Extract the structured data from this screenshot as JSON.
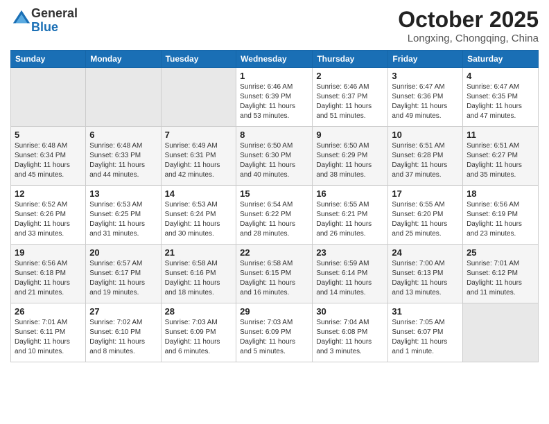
{
  "logo": {
    "general": "General",
    "blue": "Blue"
  },
  "header": {
    "month": "October 2025",
    "location": "Longxing, Chongqing, China"
  },
  "days_of_week": [
    "Sunday",
    "Monday",
    "Tuesday",
    "Wednesday",
    "Thursday",
    "Friday",
    "Saturday"
  ],
  "weeks": [
    [
      {
        "day": "",
        "info": ""
      },
      {
        "day": "",
        "info": ""
      },
      {
        "day": "",
        "info": ""
      },
      {
        "day": "1",
        "info": "Sunrise: 6:46 AM\nSunset: 6:39 PM\nDaylight: 11 hours\nand 53 minutes."
      },
      {
        "day": "2",
        "info": "Sunrise: 6:46 AM\nSunset: 6:37 PM\nDaylight: 11 hours\nand 51 minutes."
      },
      {
        "day": "3",
        "info": "Sunrise: 6:47 AM\nSunset: 6:36 PM\nDaylight: 11 hours\nand 49 minutes."
      },
      {
        "day": "4",
        "info": "Sunrise: 6:47 AM\nSunset: 6:35 PM\nDaylight: 11 hours\nand 47 minutes."
      }
    ],
    [
      {
        "day": "5",
        "info": "Sunrise: 6:48 AM\nSunset: 6:34 PM\nDaylight: 11 hours\nand 45 minutes."
      },
      {
        "day": "6",
        "info": "Sunrise: 6:48 AM\nSunset: 6:33 PM\nDaylight: 11 hours\nand 44 minutes."
      },
      {
        "day": "7",
        "info": "Sunrise: 6:49 AM\nSunset: 6:31 PM\nDaylight: 11 hours\nand 42 minutes."
      },
      {
        "day": "8",
        "info": "Sunrise: 6:50 AM\nSunset: 6:30 PM\nDaylight: 11 hours\nand 40 minutes."
      },
      {
        "day": "9",
        "info": "Sunrise: 6:50 AM\nSunset: 6:29 PM\nDaylight: 11 hours\nand 38 minutes."
      },
      {
        "day": "10",
        "info": "Sunrise: 6:51 AM\nSunset: 6:28 PM\nDaylight: 11 hours\nand 37 minutes."
      },
      {
        "day": "11",
        "info": "Sunrise: 6:51 AM\nSunset: 6:27 PM\nDaylight: 11 hours\nand 35 minutes."
      }
    ],
    [
      {
        "day": "12",
        "info": "Sunrise: 6:52 AM\nSunset: 6:26 PM\nDaylight: 11 hours\nand 33 minutes."
      },
      {
        "day": "13",
        "info": "Sunrise: 6:53 AM\nSunset: 6:25 PM\nDaylight: 11 hours\nand 31 minutes."
      },
      {
        "day": "14",
        "info": "Sunrise: 6:53 AM\nSunset: 6:24 PM\nDaylight: 11 hours\nand 30 minutes."
      },
      {
        "day": "15",
        "info": "Sunrise: 6:54 AM\nSunset: 6:22 PM\nDaylight: 11 hours\nand 28 minutes."
      },
      {
        "day": "16",
        "info": "Sunrise: 6:55 AM\nSunset: 6:21 PM\nDaylight: 11 hours\nand 26 minutes."
      },
      {
        "day": "17",
        "info": "Sunrise: 6:55 AM\nSunset: 6:20 PM\nDaylight: 11 hours\nand 25 minutes."
      },
      {
        "day": "18",
        "info": "Sunrise: 6:56 AM\nSunset: 6:19 PM\nDaylight: 11 hours\nand 23 minutes."
      }
    ],
    [
      {
        "day": "19",
        "info": "Sunrise: 6:56 AM\nSunset: 6:18 PM\nDaylight: 11 hours\nand 21 minutes."
      },
      {
        "day": "20",
        "info": "Sunrise: 6:57 AM\nSunset: 6:17 PM\nDaylight: 11 hours\nand 19 minutes."
      },
      {
        "day": "21",
        "info": "Sunrise: 6:58 AM\nSunset: 6:16 PM\nDaylight: 11 hours\nand 18 minutes."
      },
      {
        "day": "22",
        "info": "Sunrise: 6:58 AM\nSunset: 6:15 PM\nDaylight: 11 hours\nand 16 minutes."
      },
      {
        "day": "23",
        "info": "Sunrise: 6:59 AM\nSunset: 6:14 PM\nDaylight: 11 hours\nand 14 minutes."
      },
      {
        "day": "24",
        "info": "Sunrise: 7:00 AM\nSunset: 6:13 PM\nDaylight: 11 hours\nand 13 minutes."
      },
      {
        "day": "25",
        "info": "Sunrise: 7:01 AM\nSunset: 6:12 PM\nDaylight: 11 hours\nand 11 minutes."
      }
    ],
    [
      {
        "day": "26",
        "info": "Sunrise: 7:01 AM\nSunset: 6:11 PM\nDaylight: 11 hours\nand 10 minutes."
      },
      {
        "day": "27",
        "info": "Sunrise: 7:02 AM\nSunset: 6:10 PM\nDaylight: 11 hours\nand 8 minutes."
      },
      {
        "day": "28",
        "info": "Sunrise: 7:03 AM\nSunset: 6:09 PM\nDaylight: 11 hours\nand 6 minutes."
      },
      {
        "day": "29",
        "info": "Sunrise: 7:03 AM\nSunset: 6:09 PM\nDaylight: 11 hours\nand 5 minutes."
      },
      {
        "day": "30",
        "info": "Sunrise: 7:04 AM\nSunset: 6:08 PM\nDaylight: 11 hours\nand 3 minutes."
      },
      {
        "day": "31",
        "info": "Sunrise: 7:05 AM\nSunset: 6:07 PM\nDaylight: 11 hours\nand 1 minute."
      },
      {
        "day": "",
        "info": ""
      }
    ]
  ]
}
